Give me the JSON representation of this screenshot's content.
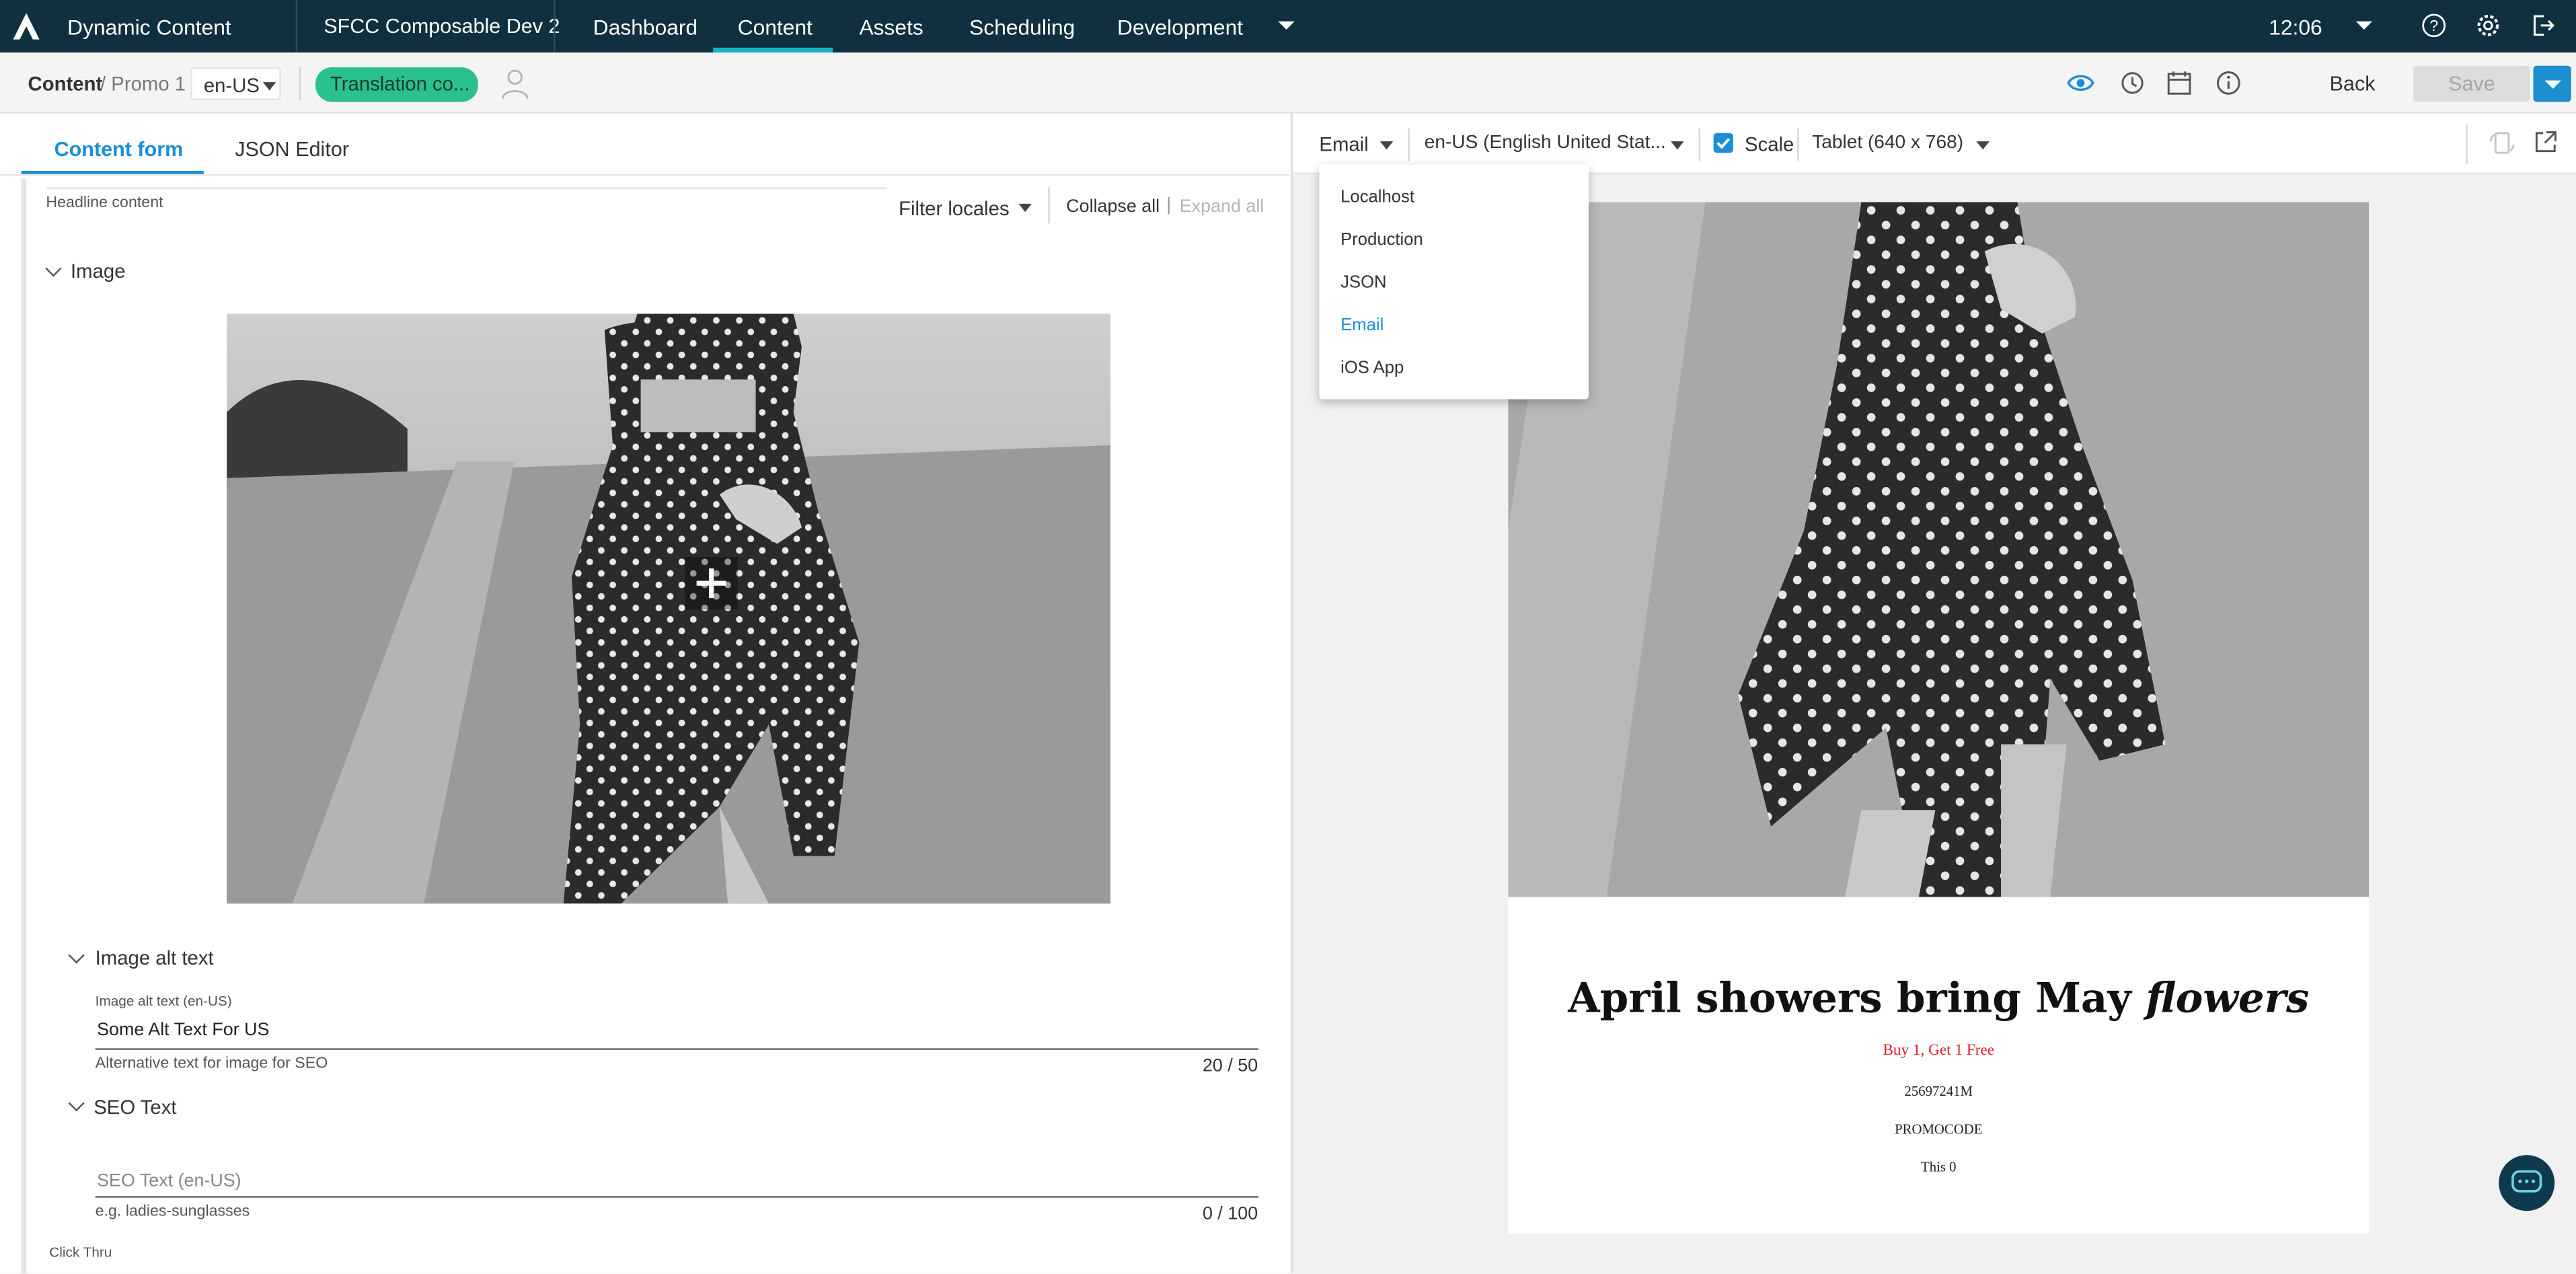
{
  "topbar": {
    "app_name": "Dynamic Content",
    "hub_name": "SFCC Composable Dev 2",
    "nav": [
      "Dashboard",
      "Content",
      "Assets",
      "Scheduling",
      "Development"
    ],
    "active_nav": "Content",
    "time": "12:06",
    "icons": [
      "help-icon",
      "settings-icon",
      "logout-icon"
    ]
  },
  "subbar": {
    "breadcrumb_root": "Content",
    "breadcrumb_item": "/ Promo 1",
    "locale": "en-US",
    "translation_button": "Translation co...",
    "back_label": "Back",
    "save_label": "Save",
    "icons": [
      "eye-icon",
      "history-icon",
      "calendar-icon",
      "info-icon"
    ]
  },
  "editor": {
    "tabs": [
      "Content form",
      "JSON Editor"
    ],
    "active_tab": "Content form",
    "headline_label": "Headline content",
    "filter_locales": "Filter locales",
    "collapse_all": "Collapse all",
    "separator": "|",
    "expand_all": "Expand all",
    "image_section": "Image",
    "alt_section": "Image alt text",
    "alt_label": "Image alt text (en-US)",
    "alt_value": "Some Alt Text For US",
    "alt_helper": "Alternative text for image for SEO",
    "alt_counter": "20 / 50",
    "seo_section": "SEO Text",
    "seo_placeholder": "SEO Text (en-US)",
    "seo_helper": "e.g. ladies-sunglasses",
    "seo_counter": "0 / 100",
    "click_thru": "Click Thru"
  },
  "preview": {
    "visualization": "Email",
    "locale": "en-US (English United Stat...",
    "scale_label": "Scale",
    "scale_checked": true,
    "device": "Tablet (640 x 768)",
    "headline_main": "April showers bring May",
    "headline_em": "flowers",
    "subline": "Buy 1, Get 1 Free",
    "code": "25697241M",
    "promocode": "PROMOCODE",
    "extra": "This 0",
    "accent_red": "#d9222a"
  },
  "dropdown": {
    "options": [
      "Localhost",
      "Production",
      "JSON",
      "Email",
      "iOS App"
    ],
    "selected": "Email"
  },
  "colors": {
    "topbar_bg": "#10303f",
    "accent_blue": "#1a8fd8",
    "translation_green": "#2bc08f"
  }
}
